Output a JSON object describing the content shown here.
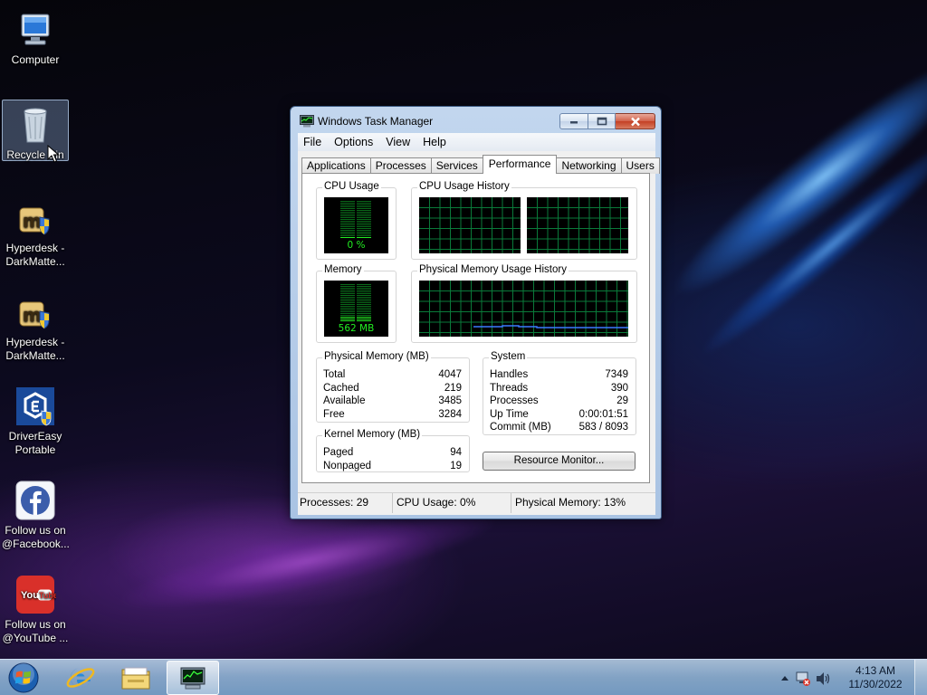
{
  "desktop": {
    "icons": [
      {
        "label": "Computer",
        "icon": "computer-icon"
      },
      {
        "label": "Recycle Bin",
        "icon": "recycle-bin-icon"
      },
      {
        "label": "Hyperdesk - DarkMatte...",
        "icon": "hyperdesk-icon"
      },
      {
        "label": "Hyperdesk - DarkMatte...",
        "icon": "hyperdesk-icon"
      },
      {
        "label": "DriverEasy Portable",
        "icon": "drivereasy-icon"
      },
      {
        "label": "Follow us on @Facebook...",
        "icon": "facebook-icon"
      },
      {
        "label": "Follow us on @YouTube ...",
        "icon": "youtube-icon"
      }
    ]
  },
  "window": {
    "title": "Windows Task Manager",
    "menu": [
      "File",
      "Options",
      "View",
      "Help"
    ],
    "tabs": [
      "Applications",
      "Processes",
      "Services",
      "Performance",
      "Networking",
      "Users"
    ],
    "selected_tab": "Performance",
    "cpu_usage": {
      "title": "CPU Usage",
      "value": "0 %",
      "percent": 0
    },
    "cpu_history": {
      "title": "CPU Usage History"
    },
    "memory": {
      "title": "Memory",
      "value": "562 MB",
      "percent": 13
    },
    "mem_history": {
      "title": "Physical Memory Usage History"
    },
    "physical_memory": {
      "title": "Physical Memory (MB)",
      "rows": [
        {
          "label": "Total",
          "value": "4047"
        },
        {
          "label": "Cached",
          "value": "219"
        },
        {
          "label": "Available",
          "value": "3485"
        },
        {
          "label": "Free",
          "value": "3284"
        }
      ]
    },
    "kernel_memory": {
      "title": "Kernel Memory (MB)",
      "rows": [
        {
          "label": "Paged",
          "value": "94"
        },
        {
          "label": "Nonpaged",
          "value": "19"
        }
      ]
    },
    "system": {
      "title": "System",
      "rows": [
        {
          "label": "Handles",
          "value": "7349"
        },
        {
          "label": "Threads",
          "value": "390"
        },
        {
          "label": "Processes",
          "value": "29"
        },
        {
          "label": "Up Time",
          "value": "0:00:01:51"
        },
        {
          "label": "Commit (MB)",
          "value": "583 / 8093"
        }
      ]
    },
    "resource_monitor_button": "Resource Monitor...",
    "status": {
      "processes": "Processes: 29",
      "cpu": "CPU Usage: 0%",
      "memory": "Physical Memory: 13%"
    }
  },
  "taskbar": {
    "time": "4:13 AM",
    "date": "11/30/2022",
    "pinned": [
      "start-orb",
      "internet-explorer-icon",
      "windows-explorer-icon",
      "task-manager-icon"
    ]
  },
  "colors": {
    "graph_green": "#22ee22",
    "grid_green": "#0a7a3a",
    "memory_line": "#3a7aff"
  }
}
